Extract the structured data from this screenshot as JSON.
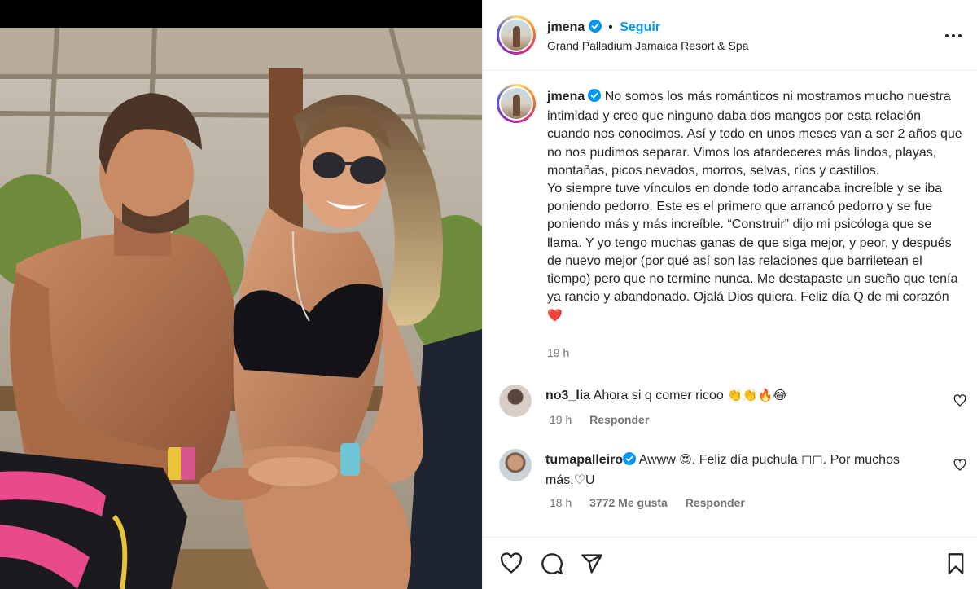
{
  "post": {
    "username": "jmena",
    "follow_label": "Seguir",
    "separator": "•",
    "location": "Grand Palladium Jamaica Resort & Spa",
    "caption": "No somos los más románticos ni mostramos mucho nuestra intimidad y creo que ninguno daba dos mangos por esta relación cuando nos conocimos. Así y todo en unos meses van a ser 2 años que no nos pudimos separar. Vimos los atardeceres más lindos, playas, montañas, picos nevados, morros, selvas, ríos y castillos.\nYo siempre tuve vínculos en donde todo arrancaba increíble y se iba poniendo pedorro. Este es el primero que arrancó pedorro y se fue poniendo más y más increíble. “Construir” dijo mi psicóloga que se llama. Y yo tengo muchas ganas de que siga mejor, y peor, y después de nuevo mejor (por qué así son las relaciones que barriletean el tiempo) pero que no termine nunca. Me destapaste un sueño que tenía ya rancio y abandonado. Ojalá Dios quiera. Feliz día Q de mi corazón",
    "caption_emoji": "❤️",
    "time": "19 h"
  },
  "comments": [
    {
      "username": "no3_lia",
      "text": "Ahora si q comer ricoo",
      "emoji": "👏👏🔥😂",
      "time": "19 h",
      "reply_label": "Responder"
    },
    {
      "username": "tumapalleiro",
      "text": "Awww",
      "emoji": "😍",
      "text_after": ". Feliz día puchula ◻◻. Por muchos más.♡U",
      "time": "18 h",
      "likes_label": "3772 Me gusta",
      "reply_label": "Responder"
    }
  ],
  "colors": {
    "accent": "#0095f6",
    "verified": "#0095f6",
    "text": "#262626",
    "muted": "#737373",
    "border": "#efefef"
  },
  "icons": [
    "more-icon",
    "verified-icon",
    "heart-icon",
    "comment-icon",
    "share-icon",
    "bookmark-icon"
  ]
}
